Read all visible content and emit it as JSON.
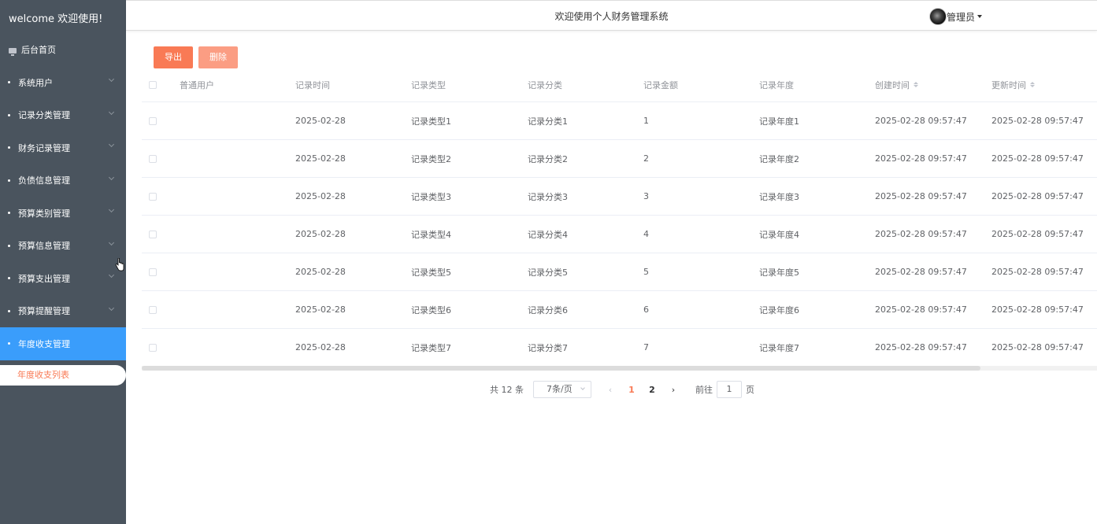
{
  "sidebar": {
    "brand": "welcome 欢迎使用!",
    "home": "后台首页",
    "items": [
      {
        "label": "系统用户"
      },
      {
        "label": "记录分类管理"
      },
      {
        "label": "财务记录管理"
      },
      {
        "label": "负债信息管理"
      },
      {
        "label": "预算类别管理"
      },
      {
        "label": "预算信息管理"
      },
      {
        "label": "预算支出管理"
      },
      {
        "label": "预算提醒管理"
      },
      {
        "label": "年度收支管理"
      }
    ],
    "submenu_item": "年度收支列表"
  },
  "header": {
    "title": "欢迎使用个人财务管理系统",
    "user": "管理员"
  },
  "toolbar": {
    "export_label": "导出",
    "delete_label": "删除"
  },
  "table": {
    "columns": [
      "普通用户",
      "记录时间",
      "记录类型",
      "记录分类",
      "记录金额",
      "记录年度",
      "创建时间",
      "更新时间"
    ],
    "rows": [
      [
        "",
        "2025-02-28",
        "记录类型1",
        "记录分类1",
        "1",
        "记录年度1",
        "2025-02-28 09:57:47",
        "2025-02-28 09:57:47"
      ],
      [
        "",
        "2025-02-28",
        "记录类型2",
        "记录分类2",
        "2",
        "记录年度2",
        "2025-02-28 09:57:47",
        "2025-02-28 09:57:47"
      ],
      [
        "",
        "2025-02-28",
        "记录类型3",
        "记录分类3",
        "3",
        "记录年度3",
        "2025-02-28 09:57:47",
        "2025-02-28 09:57:47"
      ],
      [
        "",
        "2025-02-28",
        "记录类型4",
        "记录分类4",
        "4",
        "记录年度4",
        "2025-02-28 09:57:47",
        "2025-02-28 09:57:47"
      ],
      [
        "",
        "2025-02-28",
        "记录类型5",
        "记录分类5",
        "5",
        "记录年度5",
        "2025-02-28 09:57:47",
        "2025-02-28 09:57:47"
      ],
      [
        "",
        "2025-02-28",
        "记录类型6",
        "记录分类6",
        "6",
        "记录年度6",
        "2025-02-28 09:57:47",
        "2025-02-28 09:57:47"
      ],
      [
        "",
        "2025-02-28",
        "记录类型7",
        "记录分类7",
        "7",
        "记录年度7",
        "2025-02-28 09:57:47",
        "2025-02-28 09:57:47"
      ]
    ]
  },
  "pagination": {
    "total": "共 12 条",
    "page_size": "7条/页",
    "pages": [
      "1",
      "2"
    ],
    "current": "1",
    "goto_label": "前往",
    "goto_value": "1",
    "page_suffix": "页"
  },
  "colors": {
    "sidebar_bg": "#4a545e",
    "active_menu": "#3a9dfb",
    "accent": "#f97a55"
  }
}
